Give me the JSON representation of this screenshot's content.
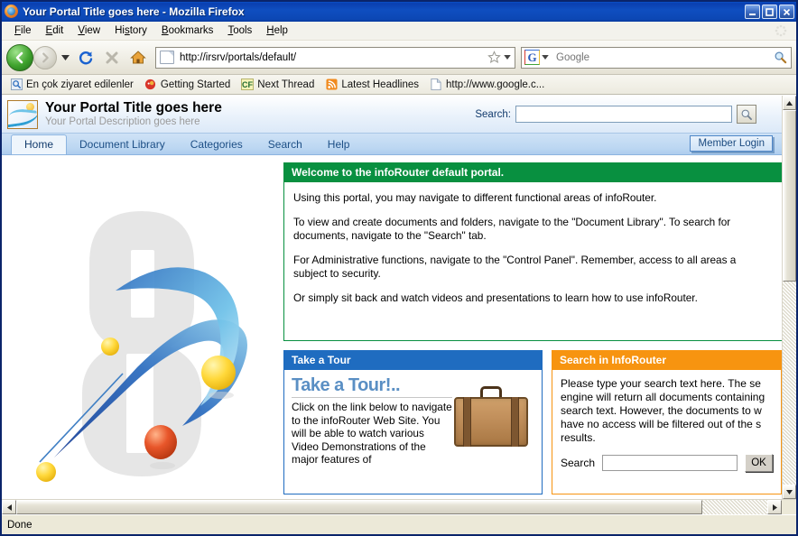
{
  "window": {
    "title": "Your Portal Title goes here - Mozilla Firefox",
    "app_icon": "firefox-icon",
    "minimize_label": "_",
    "maximize_label": "□",
    "close_label": "✕"
  },
  "menubar": {
    "items": [
      {
        "label": "File",
        "mnemonic": "F"
      },
      {
        "label": "Edit",
        "mnemonic": "E"
      },
      {
        "label": "View",
        "mnemonic": "V"
      },
      {
        "label": "History",
        "mnemonic": "s"
      },
      {
        "label": "Bookmarks",
        "mnemonic": "B"
      },
      {
        "label": "Tools",
        "mnemonic": "T"
      },
      {
        "label": "Help",
        "mnemonic": "H"
      }
    ]
  },
  "navbar": {
    "back_label": "Back",
    "forward_label": "Forward",
    "history_dropdown_label": "▼",
    "reload_label": "Reload",
    "stop_label": "Stop",
    "home_label": "Home",
    "url_value": "http://irsrv/portals/default/",
    "url_placeholder": "",
    "bookmark_star_label": "☆",
    "url_dropdown_label": "▼",
    "search_engine": "Google",
    "search_engine_letter": "G",
    "search_placeholder": "Google",
    "search_value": "",
    "search_dropdown_label": "▼"
  },
  "bookmarks": {
    "items": [
      {
        "label": "En çok ziyaret edilenler",
        "icon": "most-visited-icon"
      },
      {
        "label": "Getting Started",
        "icon": "firefox-bookmark-icon"
      },
      {
        "label": "Next Thread",
        "icon": "coldfusion-icon"
      },
      {
        "label": "Latest Headlines",
        "icon": "rss-feed-icon"
      },
      {
        "label": "http://www.google.c...",
        "icon": "page-icon"
      }
    ]
  },
  "portal": {
    "logo_icon": "portal-logo-icon",
    "title": "Your Portal Title goes here",
    "description": "Your Portal Description goes here",
    "search_label": "Search:",
    "search_value": "",
    "search_button_icon": "magnifier-icon",
    "tabs": [
      {
        "label": "Home",
        "active": true
      },
      {
        "label": "Document Library",
        "active": false
      },
      {
        "label": "Categories",
        "active": false
      },
      {
        "label": "Search",
        "active": false
      },
      {
        "label": "Help",
        "active": false
      }
    ],
    "member_login_label": "Member Login",
    "hero_image_alt": "infoRouter 8 logo artwork"
  },
  "welcome_panel": {
    "heading": "Welcome to the infoRouter default portal.",
    "header_color": "#089040",
    "paragraphs": [
      "Using this portal, you may navigate to different functional areas of infoRouter.",
      "To view and create documents and folders, navigate to the \"Document Library\". To search for\ndocuments, navigate to the \"Search\" tab.",
      "For Administrative functions, navigate to the \"Control Panel\". Remember, access to all areas a\nsubject to security.",
      "Or simply sit back and watch videos and presentations to learn how to use infoRouter."
    ]
  },
  "tour_panel": {
    "heading": "Take a Tour",
    "header_color": "#1f6cc0",
    "title": "Take a Tour!..",
    "body": "Click on the link below to navigate to the infoRouter Web Site. You will be able to watch various Video Demonstrations of the major features of",
    "image_icon": "briefcase-icon"
  },
  "search_panel": {
    "heading": "Search in InfoRouter",
    "header_color": "#f79410",
    "body": "Please type your search text here. The se\nengine will return all documents containing\nsearch text. However, the documents to w\nhave no access will be filtered out of the s\nresults.",
    "search_label": "Search",
    "search_value": "",
    "ok_label": "OK"
  },
  "scrollbars": {
    "v_up_label": "▲",
    "v_down_label": "▼",
    "h_left_label": "◀",
    "h_right_label": "▶"
  },
  "statusbar": {
    "text": "Done"
  }
}
